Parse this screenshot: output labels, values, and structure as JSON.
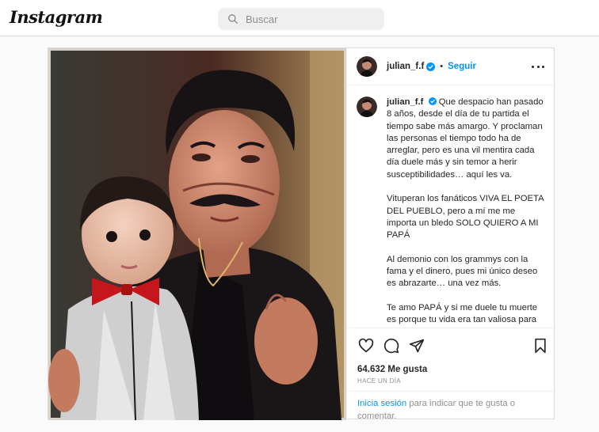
{
  "header": {
    "logo": "Instagram",
    "search_placeholder": "Buscar"
  },
  "post": {
    "username": "julian_f.f",
    "follow_label": "Seguir",
    "separator": "•",
    "caption_paragraphs": [
      "Que despacio han pasado 8 años, desde el día de tu partida el tiempo sabe más amargo. Y proclaman las personas el tiempo todo ha de arreglar, pero es una vil mentira cada día duele más y sin temor a herir susceptibilidades… aquí les va.",
      "Vituperan los fanáticos VIVA EL POETA DEL PUEBLO, pero a mí me me importa un bledo SOLO QUIERO A MI PAPÁ",
      "Al demonio con los grammys con la fama y el dinero, pues mi único deseo es abrazarte… una vez más.",
      "Te amo PAPÁ y si me duele tu muerte es porque tu vida era tan valiosa para mí"
    ],
    "likes": "64.632 Me gusta",
    "timestamp": "HACE UN DÍA",
    "login_link": "Inicia sesión",
    "login_text": " para indicar que te gusta o comentar."
  },
  "icons": {
    "search": "search-icon",
    "verified": "verified-badge-icon",
    "more": "more-options-icon",
    "like": "heart-icon",
    "comment": "comment-icon",
    "share": "share-icon",
    "save": "bookmark-icon"
  },
  "colors": {
    "accent": "#0095f6",
    "text": "#262626",
    "muted": "#8e8e8e",
    "border": "#dbdbdb",
    "background": "#fafafa"
  }
}
